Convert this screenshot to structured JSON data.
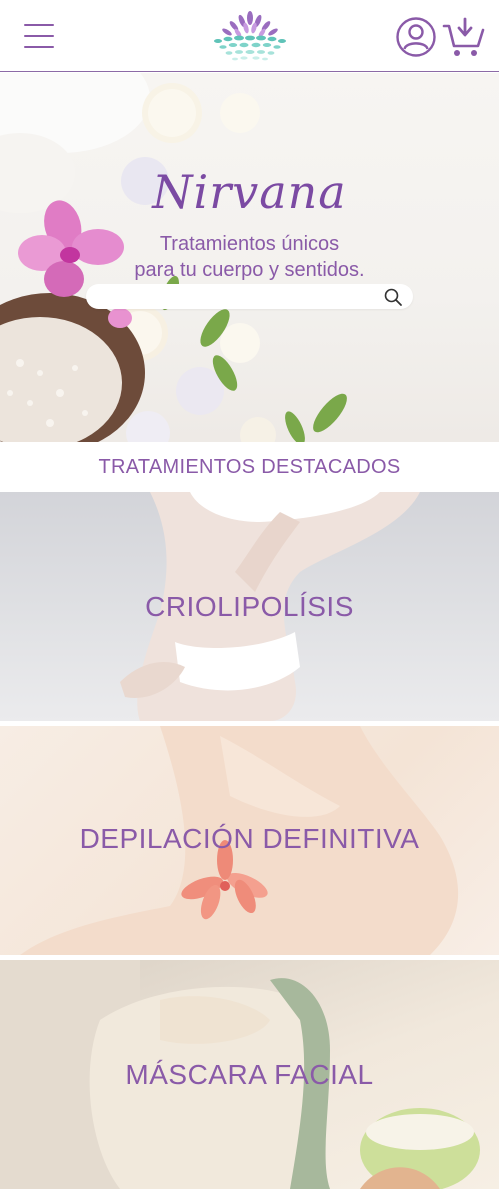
{
  "header": {
    "menu_icon": "hamburger-menu-icon",
    "logo_icon": "lotus-logo-icon",
    "user_icon": "user-account-icon",
    "cart_icon": "cart-add-icon"
  },
  "hero": {
    "brand": "Nirvana",
    "tagline_line1": "Tratamientos únicos",
    "tagline_line2": "para tu cuerpo y sentidos.",
    "search_value": "",
    "search_icon": "search-icon"
  },
  "featured": {
    "title": "TRATAMIENTOS DESTACADOS",
    "items": [
      {
        "label": "CRIOLIPOLÍSIS"
      },
      {
        "label": "DEPILACIÓN DEFINITIVA"
      },
      {
        "label": "MÁSCARA FACIAL"
      }
    ]
  },
  "colors": {
    "accent": "#8a5aa8",
    "brand_purple": "#7b4aa3",
    "header_border": "#8c6aa6",
    "logo_teal": "#5fc3b8"
  }
}
